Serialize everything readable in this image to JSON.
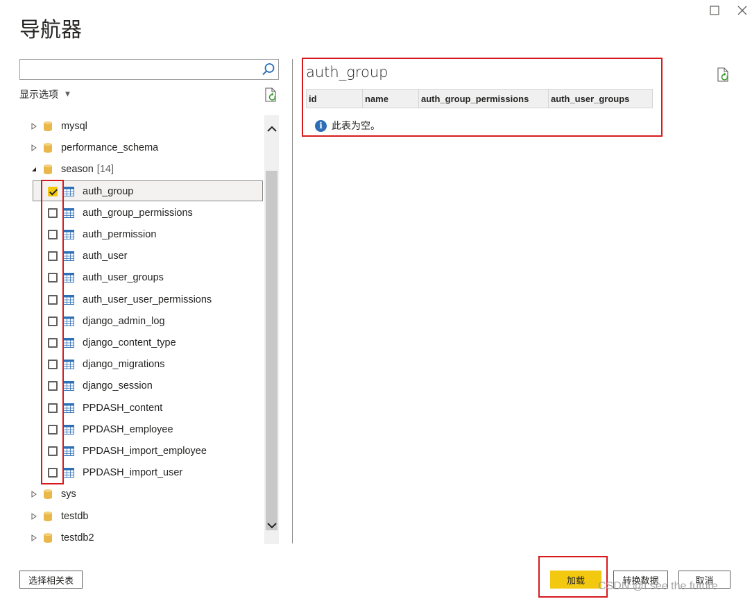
{
  "window": {
    "title": "导航器",
    "maximize_icon": "maximize-icon",
    "close_icon": "close-icon"
  },
  "search": {
    "value": "",
    "placeholder": "",
    "icon": "search-icon"
  },
  "display_options": {
    "label": "显示选项",
    "icon": "chevron-down-icon"
  },
  "tree": {
    "items": [
      {
        "label": "mysql",
        "type": "database",
        "expanded": false
      },
      {
        "label": "performance_schema",
        "type": "database",
        "expanded": false
      },
      {
        "label": "season",
        "count": "[14]",
        "type": "database",
        "expanded": true
      },
      {
        "label": "auth_group",
        "type": "table",
        "checked": true
      },
      {
        "label": "auth_group_permissions",
        "type": "table",
        "checked": false
      },
      {
        "label": "auth_permission",
        "type": "table",
        "checked": false
      },
      {
        "label": "auth_user",
        "type": "table",
        "checked": false
      },
      {
        "label": "auth_user_groups",
        "type": "table",
        "checked": false
      },
      {
        "label": "auth_user_user_permissions",
        "type": "table",
        "checked": false
      },
      {
        "label": "django_admin_log",
        "type": "table",
        "checked": false
      },
      {
        "label": "django_content_type",
        "type": "table",
        "checked": false
      },
      {
        "label": "django_migrations",
        "type": "table",
        "checked": false
      },
      {
        "label": "django_session",
        "type": "table",
        "checked": false
      },
      {
        "label": "PPDASH_content",
        "type": "table",
        "checked": false
      },
      {
        "label": "PPDASH_employee",
        "type": "table",
        "checked": false
      },
      {
        "label": "PPDASH_import_employee",
        "type": "table",
        "checked": false
      },
      {
        "label": "PPDASH_import_user",
        "type": "table",
        "checked": false
      },
      {
        "label": "sys",
        "type": "database",
        "expanded": false
      },
      {
        "label": "testdb",
        "type": "database",
        "expanded": false
      },
      {
        "label": "testdb2",
        "type": "database",
        "expanded": false
      }
    ]
  },
  "preview": {
    "title": "auth_group",
    "columns": [
      "id",
      "name",
      "auth_group_permissions",
      "auth_user_groups"
    ],
    "empty_message": "此表为空。"
  },
  "footer": {
    "select_related_label": "选择相关表",
    "load_label": "加载",
    "transform_label": "转换数据",
    "cancel_label": "取消"
  },
  "watermark": "CSDN @I see the future",
  "colors": {
    "accent": "#f2c811",
    "highlight_box": "#d7191c",
    "info": "#2c6db5",
    "db_icon": "#e8b84a",
    "table_icon": "#2e6fb5"
  }
}
